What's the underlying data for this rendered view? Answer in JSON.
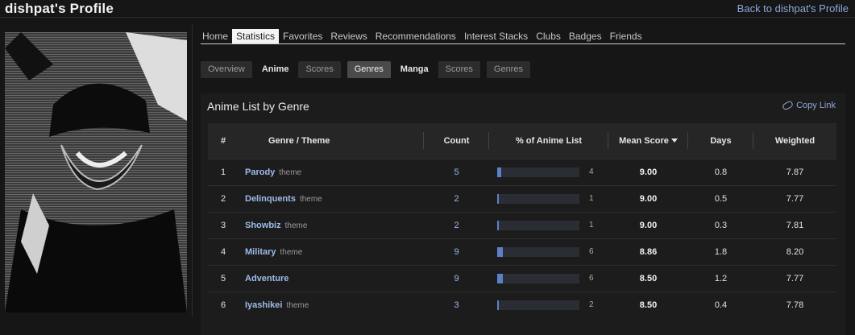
{
  "header": {
    "title": "dishpat's Profile",
    "back_link": "Back to dishpat's Profile"
  },
  "profile_image": {
    "label": "profile-picture"
  },
  "tabs": [
    "Home",
    "Statistics",
    "Favorites",
    "Reviews",
    "Recommendations",
    "Interest Stacks",
    "Clubs",
    "Badges",
    "Friends"
  ],
  "active_tab": "Statistics",
  "subtabs": [
    "Overview",
    "Anime",
    "Scores",
    "Genres",
    "Manga",
    "Scores",
    "Genres"
  ],
  "panel": {
    "title": "Anime List by Genre",
    "copy_link": "Copy Link"
  },
  "table": {
    "headers": {
      "idx": "#",
      "genre": "Genre / Theme",
      "count": "Count",
      "pct": "% of Anime List",
      "mean": "Mean Score",
      "days": "Days",
      "weighted": "Weighted"
    },
    "rows": [
      {
        "idx": "1",
        "name": "Parody",
        "tag": "theme",
        "count": "5",
        "pct": "4",
        "pct_value": 4,
        "mean": "9.00",
        "days": "0.8",
        "weighted": "7.87"
      },
      {
        "idx": "2",
        "name": "Delinquents",
        "tag": "theme",
        "count": "2",
        "pct": "1",
        "pct_value": 1,
        "mean": "9.00",
        "days": "0.5",
        "weighted": "7.77"
      },
      {
        "idx": "3",
        "name": "Showbiz",
        "tag": "theme",
        "count": "2",
        "pct": "1",
        "pct_value": 1,
        "mean": "9.00",
        "days": "0.3",
        "weighted": "7.81"
      },
      {
        "idx": "4",
        "name": "Military",
        "tag": "theme",
        "count": "9",
        "pct": "6",
        "pct_value": 6,
        "mean": "8.86",
        "days": "1.8",
        "weighted": "8.20"
      },
      {
        "idx": "5",
        "name": "Adventure",
        "tag": "",
        "count": "9",
        "pct": "6",
        "pct_value": 6,
        "mean": "8.50",
        "days": "1.2",
        "weighted": "7.77"
      },
      {
        "idx": "6",
        "name": "Iyashikei",
        "tag": "theme",
        "count": "3",
        "pct": "2",
        "pct_value": 2,
        "mean": "8.50",
        "days": "0.4",
        "weighted": "7.78"
      }
    ]
  },
  "colors": {
    "accent": "#5b80c8",
    "link": "#9dbbe8"
  }
}
